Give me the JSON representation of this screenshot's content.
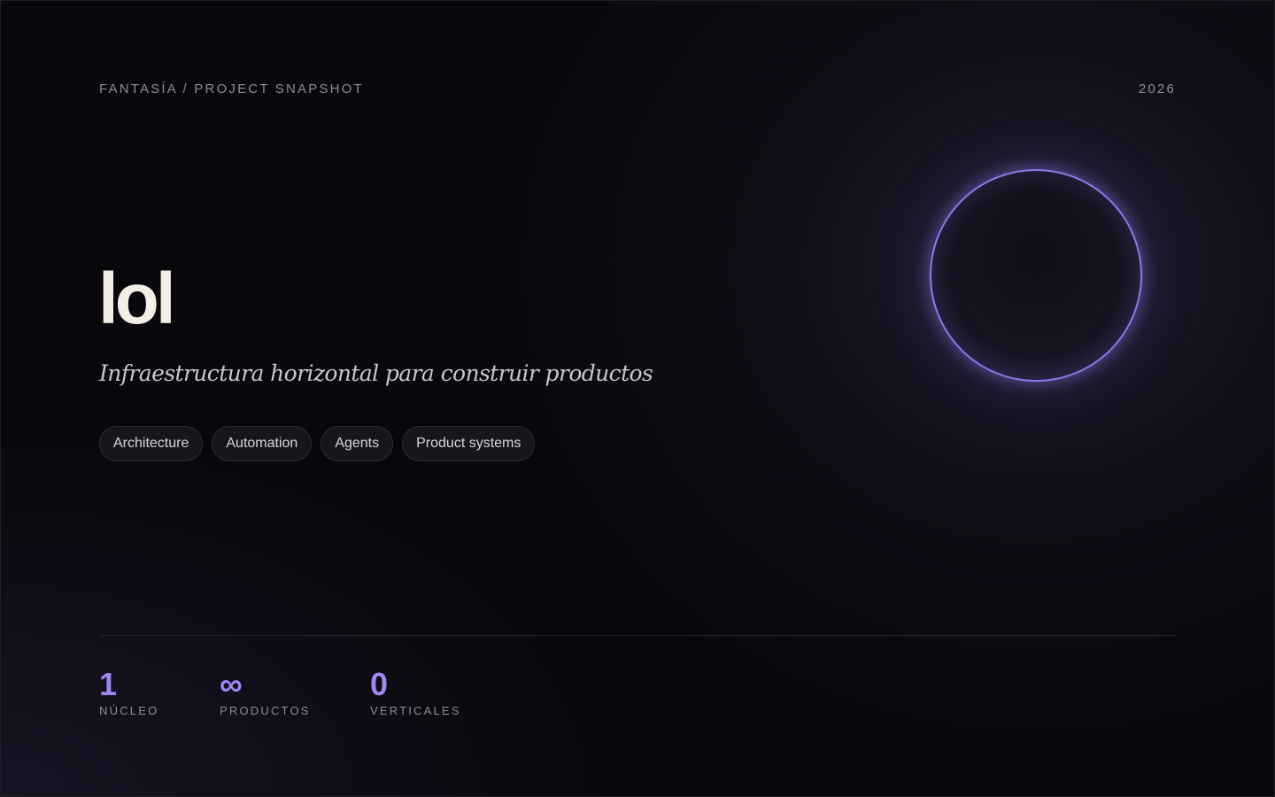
{
  "header": {
    "breadcrumb": "FANTASÍA / PROJECT SNAPSHOT",
    "year": "2026"
  },
  "hero": {
    "title": "lol",
    "subtitle": "Infraestructura horizontal para construir productos",
    "tags": [
      "Architecture",
      "Automation",
      "Agents",
      "Product systems"
    ]
  },
  "stats": [
    {
      "value": "1",
      "label": "NÚCLEO"
    },
    {
      "value": "∞",
      "label": "PRODUCTOS"
    },
    {
      "value": "0",
      "label": "VERTICALES"
    }
  ],
  "colors": {
    "background": "#08080c",
    "accent": "#9f86f4",
    "orb_ring": "#8f78ea",
    "title": "#f4efe6",
    "muted_text": "#8e8c96"
  }
}
